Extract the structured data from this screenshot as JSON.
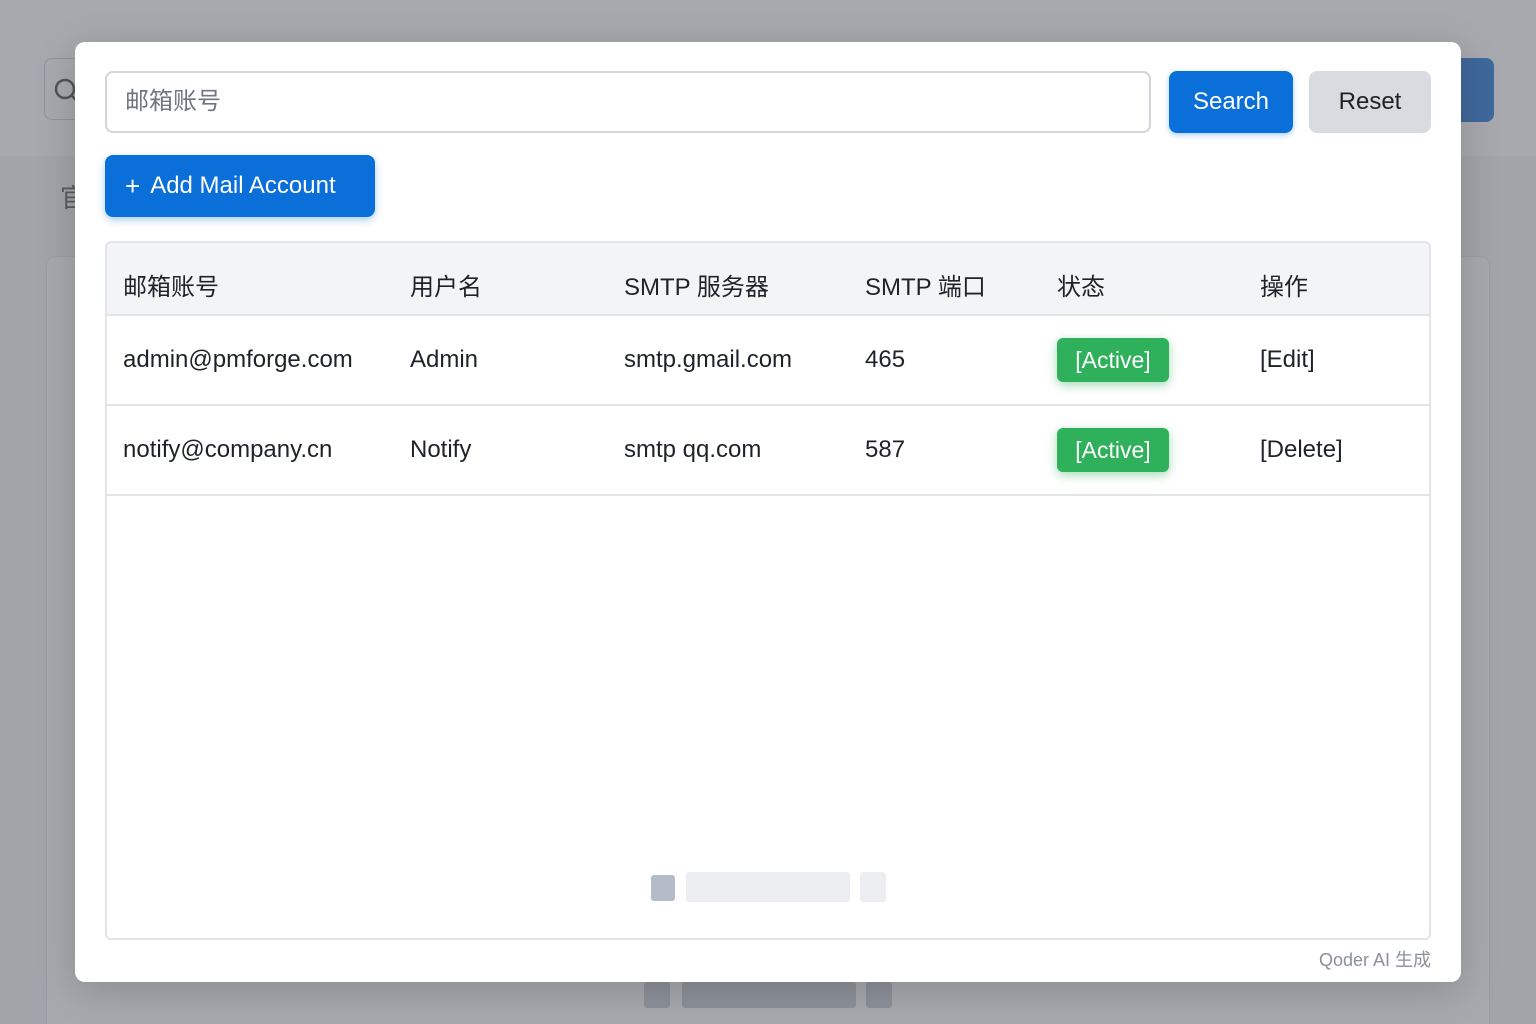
{
  "search": {
    "placeholder": "邮箱账号",
    "search_label": "Search",
    "reset_label": "Reset"
  },
  "toolbar": {
    "add_icon": "+",
    "add_label": "Add Mail Account"
  },
  "table": {
    "headers": [
      "邮箱账号",
      "用户名",
      "SMTP 服务器",
      "SMTP 端口",
      "状态",
      "操作"
    ],
    "rows": [
      {
        "email": "admin@pmforge.com",
        "username": "Admin",
        "server": "smtp.gmail.com",
        "port": "465",
        "status": "[Active]",
        "action": "[Edit]"
      },
      {
        "email": "notify@company.cn",
        "username": "Notify",
        "server": "smtp qq.com",
        "port": "587",
        "status": "[Active]",
        "action": "[Delete]"
      }
    ]
  },
  "colors": {
    "primary": "#0a6fd8",
    "status_active": "#2fb05a",
    "link": "#1767c4"
  },
  "background": {
    "side_text": "官"
  },
  "watermark": "Qoder AI 生成"
}
